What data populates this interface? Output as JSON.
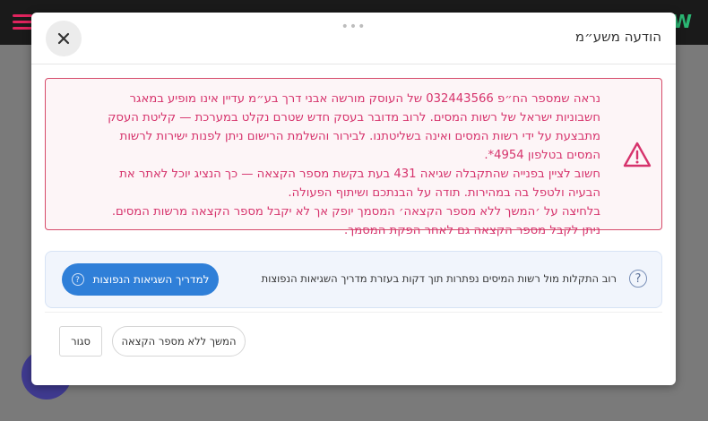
{
  "modal": {
    "title": "הודעה משע״מ",
    "close_icon": "close-icon",
    "drag_handle": "•••"
  },
  "alert": {
    "icon": "warning-triangle-icon",
    "color": "#d6336c",
    "paragraphs": [
      "נראה שמספר הח״פ 032443566 של העוסק מורשה אבני דרך בע״מ עדיין אינו מופיע במאגר חשבוניות ישראל של רשות המסים. לרוב מדובר בעסק חדש שטרם נקלט במערכת — קליטת העסק מתבצעת על ידי רשות המסים ואינה בשליטתנו. לבירור והשלמת הרישום ניתן לפנות ישירות לרשות המסים בטלפון 4954*.",
      "חשוב לציין בפנייה שהתקבלה שגיאה 431 בעת בקשת מספר הקצאה — כך הנציג יוכל לאתר את הבעיה ולטפל בה במהירות. תודה על הבנתכם ושיתוף הפעולה.",
      "בלחיצה על ׳המשך ללא מספר הקצאה׳ המסמך יופק אך לא יקבל מספר הקצאה מרשות המסים. ניתן לקבל מספר הקצאה גם לאחר הפקת המסמך."
    ]
  },
  "help": {
    "icon": "question-circle-icon",
    "text": "רוב התקלות מול רשות המיסים נפתרות תוך דקות בעזרת מדריך השגיאות הנפוצות",
    "button_label": "למדריך השגיאות הנפוצות",
    "button_color": "#2f7fd8"
  },
  "footer": {
    "continue_label": "המשך ללא מספר הקצאה",
    "close_label": "סגור"
  }
}
